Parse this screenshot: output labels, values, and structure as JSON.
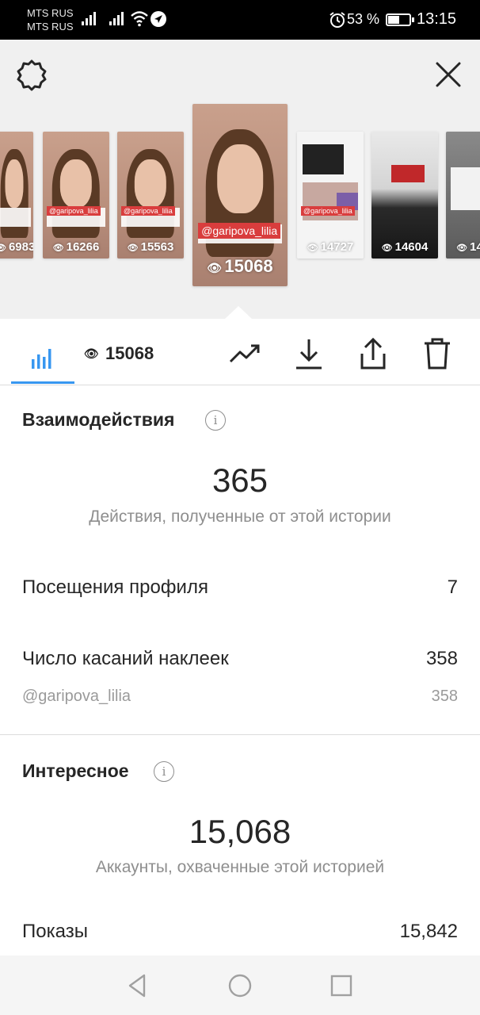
{
  "status_bar": {
    "carrier_1": "MTS RUS",
    "carrier_2": "MTS RUS",
    "battery_text": "53 %",
    "battery_level": 0.53,
    "time": "13:15"
  },
  "header": {
    "settings_icon": "gear-icon",
    "close_icon": "close-icon"
  },
  "stories": [
    {
      "views": "6983",
      "tag": "",
      "style": "portrait"
    },
    {
      "views": "16266",
      "tag": "@garipova_lilia",
      "style": "portrait"
    },
    {
      "views": "15563",
      "tag": "@garipova_lilia",
      "style": "portrait"
    },
    {
      "views": "15068",
      "tag": "@garipova_lilia",
      "style": "portrait",
      "active": true
    },
    {
      "views": "14727",
      "tag": "@garipova_lilia",
      "style": "collage"
    },
    {
      "views": "14604",
      "tag": "",
      "style": "dark"
    },
    {
      "views": "14",
      "tag": "",
      "style": "chat"
    }
  ],
  "toolbar": {
    "views_value": "15068",
    "icons": [
      "bar-chart-icon",
      "eye-icon",
      "trending-icon",
      "download-icon",
      "share-icon",
      "trash-icon"
    ]
  },
  "interactions": {
    "title": "Взаимодействия",
    "total": "365",
    "total_caption": "Действия, полученные от этой истории",
    "rows": [
      {
        "label": "Посещения профиля",
        "value": "7"
      },
      {
        "label": "Число касаний наклеек",
        "value": "358"
      }
    ],
    "sub_rows": [
      {
        "label": "@garipova_lilia",
        "value": "358"
      }
    ]
  },
  "discovery": {
    "title": "Интересное",
    "total": "15,068",
    "total_caption": "Аккаунты, охваченные этой историей",
    "rows": [
      {
        "label": "Показы",
        "value": "15,842"
      }
    ]
  },
  "colors": {
    "accent": "#3897f0",
    "tag_red": "#d93d3d",
    "text_primary": "#262626",
    "text_secondary": "#8e8e8e"
  }
}
